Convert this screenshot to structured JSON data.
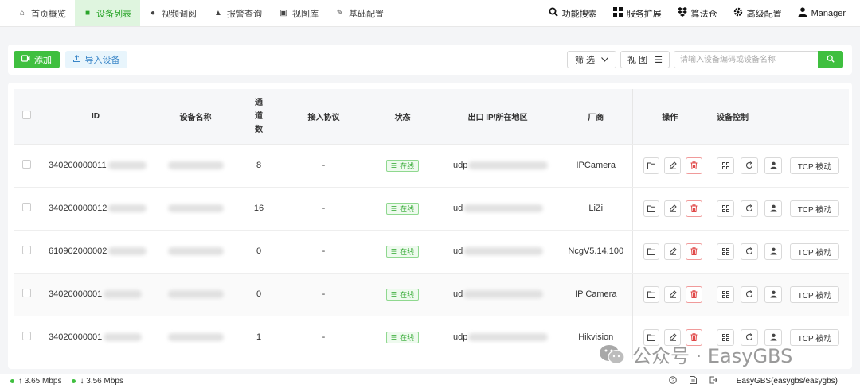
{
  "nav": {
    "items": [
      {
        "label": "首页概览",
        "icon": "home-icon",
        "active": false
      },
      {
        "label": "设备列表",
        "icon": "camera-icon",
        "active": true
      },
      {
        "label": "视频调阅",
        "icon": "play-circle-icon",
        "active": false
      },
      {
        "label": "报警查询",
        "icon": "alarm-icon",
        "active": false
      },
      {
        "label": "视图库",
        "icon": "image-icon",
        "active": false
      },
      {
        "label": "基础配置",
        "icon": "edit-icon",
        "active": false
      }
    ],
    "right": [
      {
        "label": "功能搜索",
        "icon": "search-icon"
      },
      {
        "label": "服务扩展",
        "icon": "grid-icon"
      },
      {
        "label": "算法仓",
        "icon": "dropbox-icon"
      },
      {
        "label": "高级配置",
        "icon": "gear-icon"
      },
      {
        "label": "Manager",
        "icon": "user-icon"
      }
    ]
  },
  "toolbar": {
    "add_label": "添加",
    "import_label": "导入设备",
    "filter_label": "筛 选",
    "view_label": "视 图",
    "search_placeholder": "请输入设备编码或设备名称"
  },
  "table": {
    "headers": {
      "id": "ID",
      "name": "设备名称",
      "channels": "通道数",
      "protocol": "接入协议",
      "status": "状态",
      "ip": "出口 IP/所在地区",
      "vendor": "厂商",
      "ops": "操作",
      "control": "设备控制"
    },
    "rows": [
      {
        "id": "340200000011",
        "channels": "8",
        "protocol": "-",
        "status": "在线",
        "ip": "udp",
        "vendor": "IPCamera",
        "tcp": "TCP 被动"
      },
      {
        "id": "340200000012",
        "channels": "16",
        "protocol": "-",
        "status": "在线",
        "ip": "ud",
        "vendor": "LiZi",
        "tcp": "TCP 被动"
      },
      {
        "id": "610902000002",
        "channels": "0",
        "protocol": "-",
        "status": "在线",
        "ip": "ud",
        "vendor": "NcgV5.14.100",
        "tcp": "TCP 被动"
      },
      {
        "id": "34020000001",
        "channels": "0",
        "protocol": "-",
        "status": "在线",
        "ip": "ud",
        "vendor": "IP Camera",
        "tcp": "TCP 被动"
      },
      {
        "id": "34020000001",
        "channels": "1",
        "protocol": "-",
        "status": "在线",
        "ip": "udp",
        "vendor": "Hikvision",
        "tcp": "TCP 被动"
      }
    ]
  },
  "statusbar": {
    "upload": "↑ 3.65 Mbps",
    "download": "↓ 3.56 Mbps",
    "user": "EasyGBS(easygbs/easygbs)"
  },
  "watermark": {
    "text": "公众号 · EasyGBS"
  },
  "colors": {
    "accent": "#3fbf3f",
    "active_bg": "#dff5df",
    "danger": "#e04a4a"
  }
}
